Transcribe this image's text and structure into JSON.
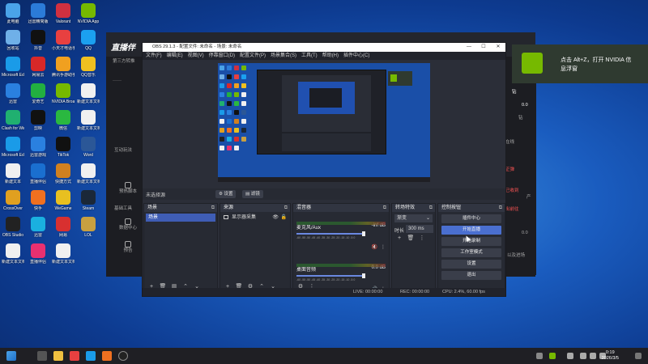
{
  "desktop_icons": [
    {
      "label": "此电脑",
      "color": "#4aa3e8"
    },
    {
      "label": "迅雷精简版",
      "color": "#2b7bd8"
    },
    {
      "label": "Valorant",
      "color": "#d03040"
    },
    {
      "label": "NVIDIA App",
      "color": "#76b900"
    },
    {
      "label": "回收站",
      "color": "#6fb0e8"
    },
    {
      "label": "抖音",
      "color": "#111111"
    },
    {
      "label": "小天才电话手表",
      "color": "#e84040"
    },
    {
      "label": "QQ",
      "color": "#1ba0f0"
    },
    {
      "label": "Microsoft Edge",
      "color": "#1a9be8"
    },
    {
      "label": "网易云",
      "color": "#d82828"
    },
    {
      "label": "腾讯手游助手",
      "color": "#f0a020"
    },
    {
      "label": "QQ音乐",
      "color": "#f0c020"
    },
    {
      "label": "迅雷",
      "color": "#2a80e0"
    },
    {
      "label": "爱奇艺",
      "color": "#22b040"
    },
    {
      "label": "NVIDIA Broadcast",
      "color": "#76b900"
    },
    {
      "label": "新建文本文档",
      "color": "#f0f0f0"
    },
    {
      "label": "Clash for Windows",
      "color": "#20b070"
    },
    {
      "label": "剪映",
      "color": "#111111"
    },
    {
      "label": "微信",
      "color": "#2ab840"
    },
    {
      "label": "新建文本文档",
      "color": "#f0f0f0"
    },
    {
      "label": "Microsoft Edge",
      "color": "#1a9be8"
    },
    {
      "label": "迅雷游戏",
      "color": "#2a80e0"
    },
    {
      "label": "TikTok",
      "color": "#111111"
    },
    {
      "label": "Word",
      "color": "#2b5797"
    },
    {
      "label": "新建文本",
      "color": "#f0f0f0"
    },
    {
      "label": "直播伴侣",
      "color": "#1a6fd0"
    },
    {
      "label": "快捷方式",
      "color": "#d08020"
    },
    {
      "label": "新建文本文档",
      "color": "#f0f0f0"
    },
    {
      "label": "CrossOver",
      "color": "#e0a020"
    },
    {
      "label": "快手",
      "color": "#f07020"
    },
    {
      "label": "WeGame",
      "color": "#e8c020"
    },
    {
      "label": "Steam",
      "color": "#1b2838"
    },
    {
      "label": "OBS Studio",
      "color": "#222222"
    },
    {
      "label": "迅雷",
      "color": "#1ab0e0"
    },
    {
      "label": "网易",
      "color": "#d83030"
    },
    {
      "label": "LOL",
      "color": "#c8a040"
    },
    {
      "label": "新建文本文档",
      "color": "#f0f0f0"
    },
    {
      "label": "直播伴侣",
      "color": "#e83070"
    },
    {
      "label": "新建文本文档",
      "color": "#f0f0f0"
    }
  ],
  "bg_app": {
    "logo": "直播伴",
    "sidebar_text": [
      "第三方转推",
      "互动玩法",
      "基础工具"
    ],
    "sidebar_items": [
      "预热脚本",
      "数据中心",
      "预告"
    ],
    "right_text": [
      "钻",
      "0.0",
      "钻",
      "在线",
      "正弹",
      "己收到",
      "产",
      "出前往",
      "0.0",
      "以及进场"
    ]
  },
  "obs": {
    "title": "OBS 29.1.3 - 配置文件: 未命名 - 场景: 未命名",
    "menu": [
      "文件(F)",
      "编辑(E)",
      "视图(V)",
      "停靠窗口(D)",
      "配置文件(P)",
      "场景集合(S)",
      "工具(T)",
      "帮助(H)",
      "插件中心(C)"
    ],
    "no_source": "未选择源",
    "props_btn": "设置",
    "filters_btn": "滤镜",
    "docks": {
      "scenes": {
        "title": "场景",
        "items": [
          "场景"
        ]
      },
      "sources": {
        "title": "来源",
        "items": [
          "显示器采集"
        ]
      },
      "mixer": {
        "title": "混音器",
        "channels": [
          {
            "name": "麦克风/Aux",
            "db": "-inf dB"
          },
          {
            "name": "桌面音频",
            "db": "0.0 dB"
          }
        ],
        "scale": "-60 -55 -50 -45 -40 -35 -30 -25 -20 -15 -10 -5 0"
      },
      "transitions": {
        "title": "转场特效",
        "type": "渐变",
        "duration_label": "时长",
        "duration": "300 ms"
      },
      "controls": {
        "title": "控制按钮",
        "buttons": [
          "插件中心",
          "开始直播",
          "开始录制",
          "工作室模式",
          "设置",
          "退出"
        ]
      }
    },
    "status": {
      "live": "LIVE: 00:00:00",
      "rec": "REC: 00:00:00",
      "cpu": "CPU: 2.4%, 60.00 fps"
    }
  },
  "notification": {
    "line1": "点击 Alt+Z，打开 NVIDIA 信",
    "line2": "息浮窗"
  },
  "taskbar": {
    "time": "0:19",
    "date": "2026/3/5"
  }
}
